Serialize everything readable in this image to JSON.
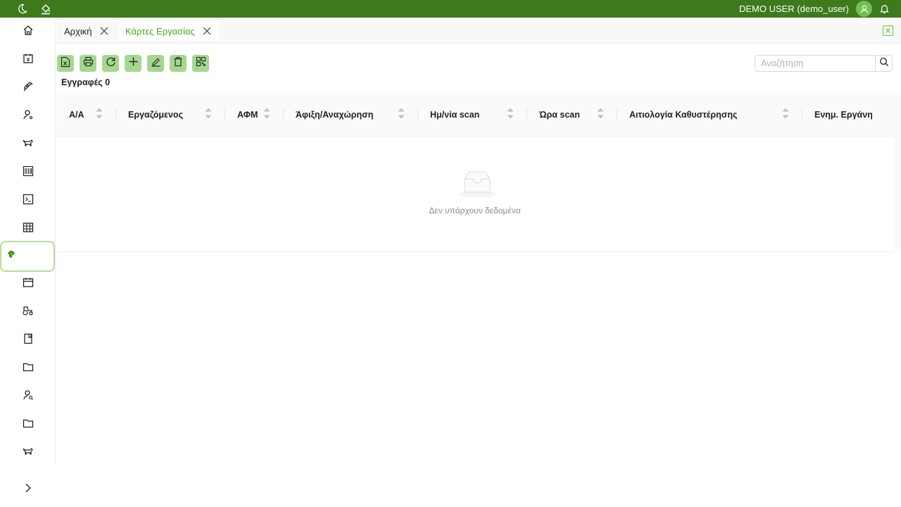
{
  "topbar": {
    "user": "DEMO USER (demo_user)",
    "icons": [
      "moon-icon",
      "paint-bucket-icon",
      "user-avatar-icon",
      "bell-icon"
    ]
  },
  "sidebar": {
    "items": [
      {
        "icon": "home-icon"
      },
      {
        "icon": "calendar-yen-icon"
      },
      {
        "icon": "syringe-icon"
      },
      {
        "icon": "user-settings-icon"
      },
      {
        "icon": "cow-icon"
      },
      {
        "icon": "barcode-icon"
      },
      {
        "icon": "terminal-icon"
      },
      {
        "icon": "table-icon"
      },
      {
        "icon": "fingerprint-icon",
        "active": true
      },
      {
        "icon": "calendar-icon"
      },
      {
        "icon": "tractor-icon"
      },
      {
        "icon": "book-icon"
      },
      {
        "icon": "folder-icon"
      },
      {
        "icon": "user-search-icon"
      },
      {
        "icon": "folder-icon"
      },
      {
        "icon": "cow-icon"
      }
    ],
    "expand_icon": "chevron-right-icon"
  },
  "tabs": [
    {
      "label": "Αρχική",
      "active": false
    },
    {
      "label": "Κάρτες Εργασίας",
      "active": true
    }
  ],
  "toolbar": {
    "buttons": [
      "excel-export-icon",
      "print-icon",
      "refresh-icon",
      "add-icon",
      "edit-icon",
      "delete-icon",
      "qr-code-icon"
    ]
  },
  "records_label": "Εγγραφές 0",
  "search": {
    "placeholder": "Αναζήτηση",
    "value": ""
  },
  "table": {
    "columns": [
      "Α/Α",
      "Εργαζόμενος",
      "ΑΦΜ",
      "Άφιξη/Αναχώρηση",
      "Ημ/νία scan",
      "Ώρα scan",
      "Αιτιολογία Καθυστέρησης",
      "Ενημ. Εργάνη"
    ],
    "rows": [],
    "empty_text": "Δεν υπάρχουν δεδομένα"
  },
  "colors": {
    "brand": "#3c7a1c",
    "accent": "#4aa61f",
    "button_bg": "#a5d88f"
  }
}
